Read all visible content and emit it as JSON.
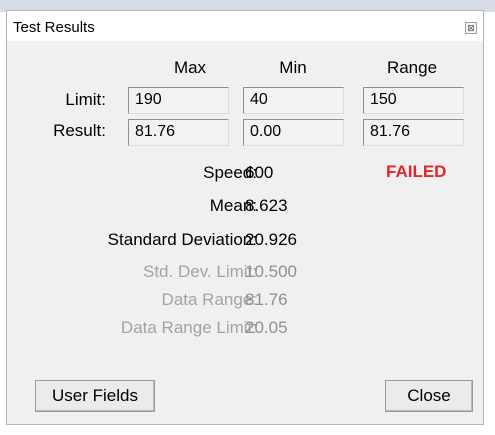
{
  "window": {
    "title": "Test Results",
    "close_glyph": "⊠"
  },
  "columns": [
    "Max",
    "Min",
    "Range"
  ],
  "limit": {
    "label": "Limit:",
    "max": "190",
    "min": "40",
    "range": "150"
  },
  "result": {
    "label": "Result:",
    "max": "81.76",
    "min": "0.00",
    "range": "81.76"
  },
  "status": {
    "text": "FAILED",
    "color": "#e3262a"
  },
  "stats": {
    "speed": {
      "label": "Speed:",
      "value": "600"
    },
    "mean": {
      "label": "Mean:",
      "value": "8.623"
    },
    "std_dev": {
      "label": "Standard Deviation:",
      "value": "20.926"
    },
    "std_dev_limit": {
      "label": "Std. Dev. Limit:",
      "value": "10.500"
    },
    "data_range": {
      "label": "Data Range:",
      "value": "81.76"
    },
    "data_range_limit": {
      "label": "Data Range Limit:",
      "value": "20.05"
    }
  },
  "buttons": {
    "user_fields": "User Fields",
    "close": "Close"
  }
}
